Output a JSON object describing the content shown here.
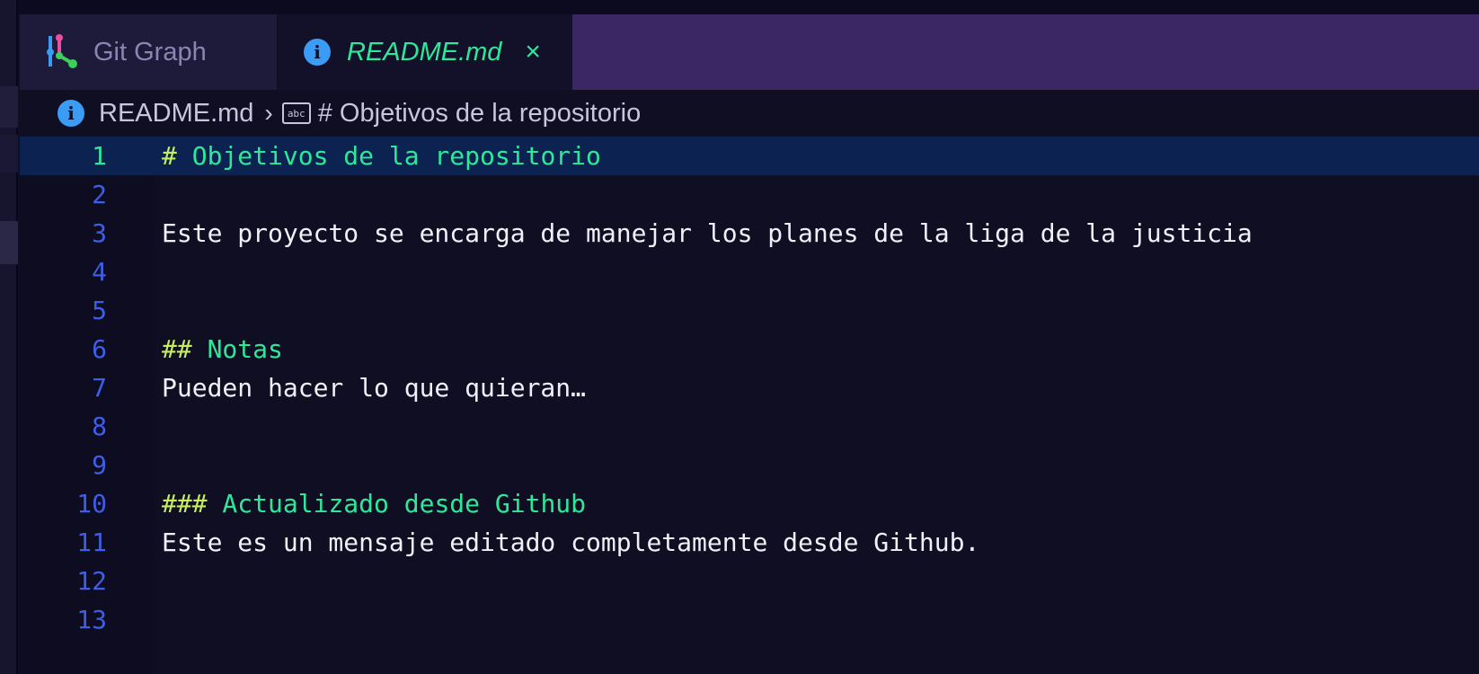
{
  "tabs": [
    {
      "label": "Git Graph",
      "icon": "git-graph-icon",
      "active": false
    },
    {
      "label": "README.md",
      "icon": "info-icon",
      "active": true,
      "close": "×"
    }
  ],
  "breadcrumb": {
    "file": "README.md",
    "separator": "›",
    "symbol_icon": "abc",
    "symbol": "# Objetivos de la repositorio"
  },
  "editor": {
    "current_line": 1,
    "lines": [
      {
        "n": "1",
        "hash": "#",
        "text": " Objetivos de la repositorio",
        "kind": "heading"
      },
      {
        "n": "2",
        "hash": "",
        "text": "",
        "kind": "text"
      },
      {
        "n": "3",
        "hash": "",
        "text": "Este proyecto se encarga de manejar los planes de la liga de la justicia",
        "kind": "text"
      },
      {
        "n": "4",
        "hash": "",
        "text": "",
        "kind": "text"
      },
      {
        "n": "5",
        "hash": "",
        "text": "",
        "kind": "text"
      },
      {
        "n": "6",
        "hash": "##",
        "text": " Notas",
        "kind": "heading"
      },
      {
        "n": "7",
        "hash": "",
        "text": "Pueden hacer lo que quieran…",
        "kind": "text"
      },
      {
        "n": "8",
        "hash": "",
        "text": "",
        "kind": "text"
      },
      {
        "n": "9",
        "hash": "",
        "text": "",
        "kind": "text"
      },
      {
        "n": "10",
        "hash": "###",
        "text": " Actualizado desde Github",
        "kind": "heading"
      },
      {
        "n": "11",
        "hash": "",
        "text": "Este es un mensaje editado completamente desde Github.",
        "kind": "text"
      },
      {
        "n": "12",
        "hash": "",
        "text": "",
        "kind": "text"
      },
      {
        "n": "13",
        "hash": "",
        "text": "",
        "kind": "text"
      }
    ]
  },
  "colors": {
    "accent": "#2ee89a",
    "line_number": "#3d5ee8",
    "hash": "#c6ee5e",
    "tabbar": "#3a2764",
    "info_icon": "#3b9cf5"
  }
}
